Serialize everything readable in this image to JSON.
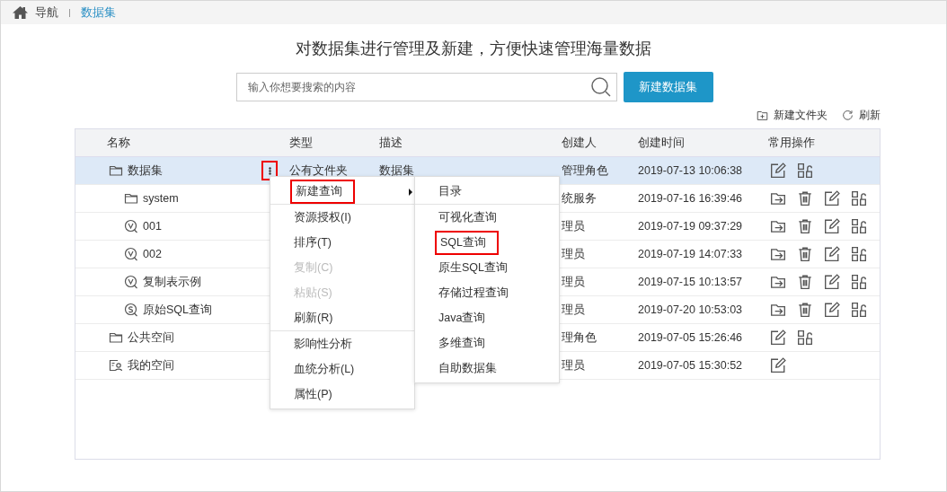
{
  "breadcrumb": [
    {
      "label": "导航",
      "selected": false
    },
    {
      "label": "数据集",
      "selected": true
    }
  ],
  "heading": "对数据集进行管理及新建，方便快速管理海量数据",
  "search": {
    "placeholder": "输入你想要搜索的内容"
  },
  "create_button": "新建数据集",
  "toolbar": [
    {
      "kind": "new-folder",
      "label": "新建文件夹"
    },
    {
      "kind": "refresh",
      "label": "刷新"
    }
  ],
  "table": {
    "columns": [
      "名称",
      "类型",
      "描述",
      "创建人",
      "创建时间",
      "常用操作"
    ],
    "rows": [
      {
        "name": "数据集",
        "kind": "folder",
        "type": "公有文件夹",
        "description": "数据集",
        "creator": "管理角色",
        "created": "2019-07-13 10:06:38",
        "selected": true,
        "actions": [
          {
            "kind": "edit"
          },
          {
            "kind": "permission"
          }
        ],
        "children": [
          {
            "name": "system",
            "kind": "folder",
            "creator": "统服务",
            "created": "2019-07-16 16:39:46",
            "selected": false,
            "actions": [
              {
                "kind": "move"
              },
              {
                "kind": "delete"
              },
              {
                "kind": "edit"
              },
              {
                "kind": "permission"
              }
            ]
          },
          {
            "name": "001",
            "kind": "view",
            "creator": "理员",
            "created": "2019-07-19 09:37:29",
            "selected": false,
            "actions": [
              {
                "kind": "move"
              },
              {
                "kind": "delete"
              },
              {
                "kind": "edit"
              },
              {
                "kind": "permission"
              }
            ]
          },
          {
            "name": "002",
            "kind": "view",
            "creator": "理员",
            "created": "2019-07-19 14:07:33",
            "selected": false,
            "actions": [
              {
                "kind": "move"
              },
              {
                "kind": "delete"
              },
              {
                "kind": "edit"
              },
              {
                "kind": "permission"
              }
            ]
          },
          {
            "name": "复制表示例",
            "kind": "view",
            "creator": "理员",
            "created": "2019-07-15 10:13:57",
            "selected": false,
            "actions": [
              {
                "kind": "move"
              },
              {
                "kind": "delete"
              },
              {
                "kind": "edit"
              },
              {
                "kind": "permission"
              }
            ]
          },
          {
            "name": "原始SQL查询",
            "kind": "sql",
            "creator": "理员",
            "created": "2019-07-20 10:53:03",
            "selected": false,
            "actions": [
              {
                "kind": "move"
              },
              {
                "kind": "delete"
              },
              {
                "kind": "edit"
              },
              {
                "kind": "permission"
              }
            ]
          }
        ]
      },
      {
        "name": "公共空间",
        "kind": "folder",
        "creator": "理角色",
        "created": "2019-07-05 15:26:46",
        "selected": false,
        "actions": [
          {
            "kind": "edit"
          },
          {
            "kind": "permission"
          }
        ]
      },
      {
        "name": "我的空间",
        "kind": "personal",
        "creator": "理员",
        "created": "2019-07-05 15:30:52",
        "selected": false,
        "actions": [
          {
            "kind": "edit"
          }
        ]
      }
    ]
  },
  "context_menu": {
    "trigger_highlighted": true,
    "items": [
      {
        "label": "新建查询",
        "disabled": false,
        "highlighted": true,
        "submenu": true,
        "divider_after": true
      },
      {
        "label": "资源授权(I)",
        "disabled": false,
        "highlighted": false,
        "submenu": false,
        "divider_after": false
      },
      {
        "label": "排序(T)",
        "disabled": false,
        "highlighted": false,
        "submenu": false,
        "divider_after": false
      },
      {
        "label": "复制(C)",
        "disabled": true,
        "highlighted": false,
        "submenu": false,
        "divider_after": false
      },
      {
        "label": "粘贴(S)",
        "disabled": true,
        "highlighted": false,
        "submenu": false,
        "divider_after": false
      },
      {
        "label": "刷新(R)",
        "disabled": false,
        "highlighted": false,
        "submenu": false,
        "divider_after": true
      },
      {
        "label": "影响性分析",
        "disabled": false,
        "highlighted": false,
        "submenu": false,
        "divider_after": false
      },
      {
        "label": "血统分析(L)",
        "disabled": false,
        "highlighted": false,
        "submenu": false,
        "divider_after": false
      },
      {
        "label": "属性(P)",
        "disabled": false,
        "highlighted": false,
        "submenu": false,
        "divider_after": false
      }
    ]
  },
  "submenu": {
    "items": [
      {
        "label": "目录",
        "highlighted": false,
        "divider_after": true
      },
      {
        "label": "可视化查询",
        "highlighted": false,
        "divider_after": false
      },
      {
        "label": "SQL查询",
        "highlighted": true,
        "divider_after": false
      },
      {
        "label": "原生SQL查询",
        "highlighted": false,
        "divider_after": false
      },
      {
        "label": "存储过程查询",
        "highlighted": false,
        "divider_after": false
      },
      {
        "label": "Java查询",
        "highlighted": false,
        "divider_after": false
      },
      {
        "label": "多维查询",
        "highlighted": false,
        "divider_after": false
      },
      {
        "label": "自助数据集",
        "highlighted": false,
        "divider_after": false
      }
    ]
  }
}
